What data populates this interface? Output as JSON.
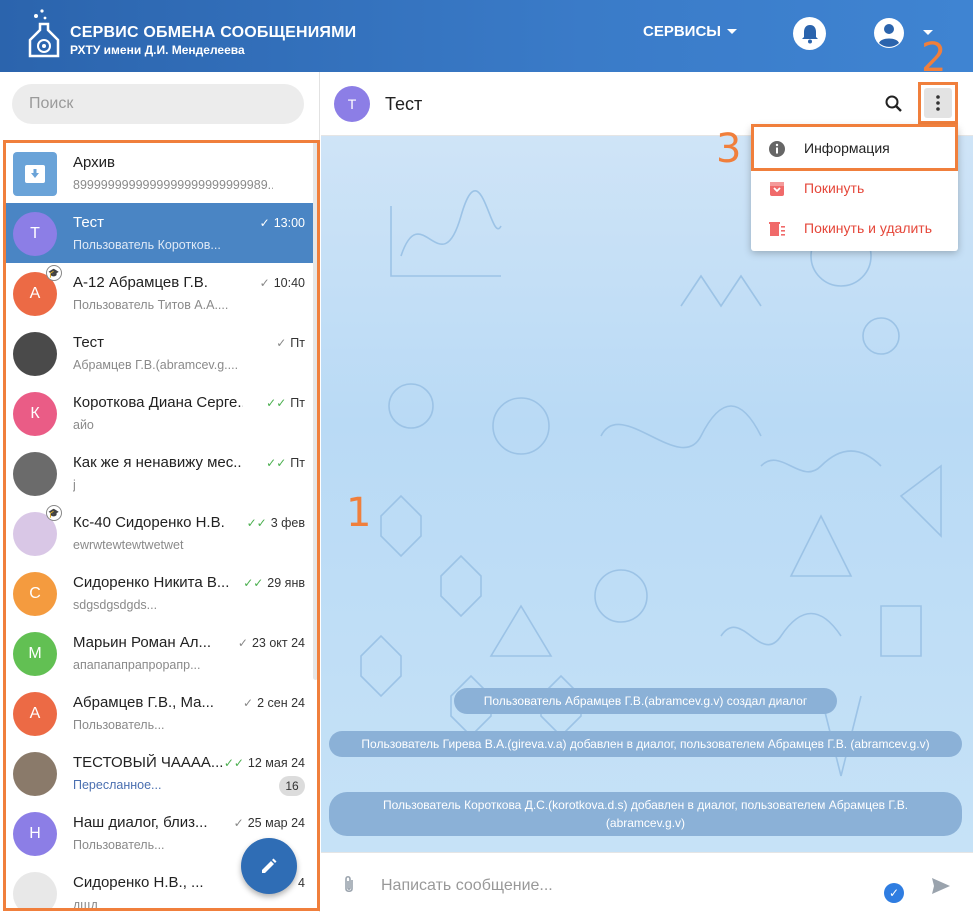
{
  "header": {
    "brand_title": "СЕРВИС ОБМЕНА СООБЩЕНИЯМИ",
    "brand_subtitle": "РХТУ имени Д.И. Менделеева",
    "services_label": "СЕРВИСЫ"
  },
  "sidebar": {
    "search_placeholder": "Поиск",
    "chats": [
      {
        "name": "Архив",
        "last": "8999999999999999999999999989...",
        "time": "",
        "avatar_letter": "",
        "avatar_color": "#6aa3d8"
      },
      {
        "name": "Тест",
        "last": "Пользователь Коротков...",
        "time": "13:00",
        "avatar_letter": "Т",
        "avatar_color": "#8c7ee6",
        "active": true
      },
      {
        "name": "А-12 Абрамцев Г.В.",
        "last": "Пользователь Титов А.А....",
        "time": "10:40",
        "avatar_letter": "А",
        "avatar_color": "#ec6a45"
      },
      {
        "name": "Тест",
        "last": "Абрамцев Г.В.(abramcev.g....",
        "time": "Пт",
        "avatar_letter": "",
        "avatar_color": "#4a4a4a"
      },
      {
        "name": "Короткова Диана Серге...",
        "last": "айо",
        "time": "Пт",
        "avatar_letter": "К",
        "avatar_color": "#ea5c86"
      },
      {
        "name": "Как же я ненавижу мес...",
        "last": "j",
        "time": "Пт",
        "avatar_letter": "",
        "avatar_color": "#6b6b6b"
      },
      {
        "name": "Кс-40 Сидоренко Н.В.",
        "last": "ewrwtewtewtwetwet",
        "time": "3 фев",
        "avatar_letter": "",
        "avatar_color": "#d9c7e6"
      },
      {
        "name": "Сидоренко Никита В...",
        "last": "sdgsdgsdgds...",
        "time": "29 янв",
        "avatar_letter": "С",
        "avatar_color": "#f49b3f"
      },
      {
        "name": "Марьин Роман Ал...",
        "last": "апапапапрапрорапр...",
        "time": "23 окт 24",
        "avatar_letter": "М",
        "avatar_color": "#62c053"
      },
      {
        "name": "Абрамцев Г.В., Ма...",
        "last": "Пользователь...",
        "time": "2 сен 24",
        "avatar_letter": "А",
        "avatar_color": "#ec6a45"
      },
      {
        "name": "ТЕСТОВЫЙ ЧАААА...",
        "last": "Пересланное...",
        "time": "12 мая 24",
        "avatar_letter": "",
        "avatar_color": "#8a7a6a",
        "unread": "16"
      },
      {
        "name": "Наш диалог, близ...",
        "last": "Пользователь...",
        "time": "25 мар 24",
        "avatar_letter": "Н",
        "avatar_color": "#8c7ee6"
      },
      {
        "name": "Сидоренко Н.В., ...",
        "last": "дщд",
        "time": "4",
        "avatar_letter": "",
        "avatar_color": "#e8e8e8"
      }
    ]
  },
  "chat": {
    "title": "Тест",
    "avatar_letter": "Т",
    "system_messages": [
      "Пользователь Абрамцев Г.В.(abramcev.g.v) создал диалог",
      "Пользователь Гирева В.А.(gireva.v.a) добавлен в диалог, пользователем Абрамцев Г.В. (abramcev.g.v)",
      "Пользователь Короткова Д.С.(korotkova.d.s) добавлен в диалог, пользователем Абрамцев Г.В. (abramcev.g.v)"
    ],
    "composer_placeholder": "Написать сообщение..."
  },
  "menu": {
    "info": "Информация",
    "leave": "Покинуть",
    "leave_delete": "Покинуть и удалить"
  },
  "annotations": {
    "a1": "1",
    "a2": "2",
    "a3": "3"
  },
  "colors": {
    "accent": "#2f6db5",
    "annotation": "#f07f3c",
    "danger": "#e5473a"
  }
}
